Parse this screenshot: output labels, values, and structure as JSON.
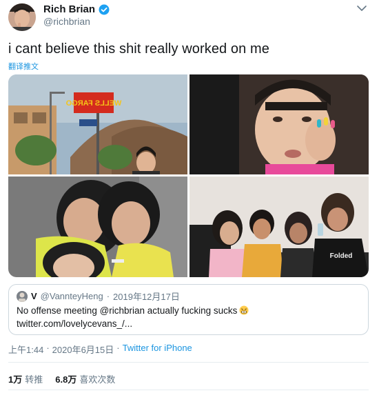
{
  "author": {
    "name": "Rich Brian",
    "handle": "@richbrian"
  },
  "tweet": {
    "text": "i cant believe this shit really worked on me",
    "translate_label": "翻译推文"
  },
  "photos": [
    {
      "sign_text": "WELLS FARGO"
    },
    {},
    {},
    {
      "shirt_text": "Folded"
    }
  ],
  "quote": {
    "name": "V",
    "handle": "@VannteyHeng",
    "separator": "·",
    "date": "2019年12月17日",
    "body_line1": "No offense meeting @richbrian actually fucking sucks",
    "body_line2": "twitter.com/lovelycevans_/..."
  },
  "meta": {
    "time": "上午1:44",
    "date": "2020年6月15日",
    "separator1": "·",
    "separator2": "·",
    "source": "Twitter for iPhone"
  },
  "stats": {
    "retweets_count": "1万",
    "retweets_label": "转推",
    "likes_count": "6.8万",
    "likes_label": "喜欢次数"
  },
  "colors": {
    "link": "#1b95e0",
    "secondary_text": "#657786",
    "verified": "#1da1f2"
  },
  "icons": [
    "verified-badge-icon",
    "chevron-down-icon",
    "grimace-emoji-icon"
  ]
}
